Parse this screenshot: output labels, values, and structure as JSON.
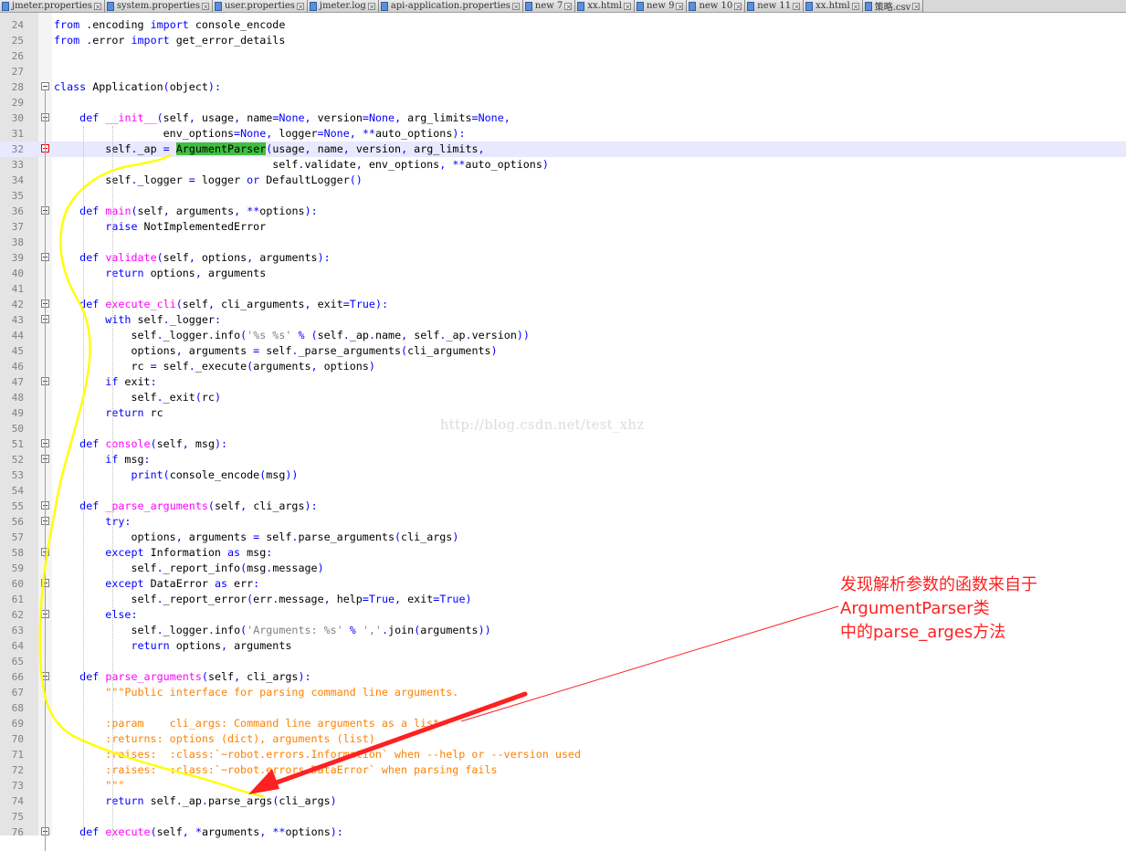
{
  "tabs": [
    {
      "label": "jmeter.properties"
    },
    {
      "label": "system.properties"
    },
    {
      "label": "user.properties"
    },
    {
      "label": "jmeter.log"
    },
    {
      "label": "api-application.properties"
    },
    {
      "label": "new 7"
    },
    {
      "label": "xx.html"
    },
    {
      "label": "new 9"
    },
    {
      "label": "new 10"
    },
    {
      "label": "new 11"
    },
    {
      "label": "xx.html"
    },
    {
      "label": "策略.csv"
    }
  ],
  "editor": {
    "current_line": 32,
    "highlight_word": "ArgumentParser",
    "watermark": "http://blog.csdn.net/test_xhz",
    "annotation": [
      "发现解析参数的函数来自于",
      "ArgumentParser类",
      "中的parse_arges方法"
    ],
    "lines": [
      {
        "n": "24",
        "fold": "",
        "t": "from .encoding import console_encode"
      },
      {
        "n": "25",
        "fold": "",
        "t": "from .error import get_error_details"
      },
      {
        "n": "26",
        "fold": "",
        "t": ""
      },
      {
        "n": "27",
        "fold": "",
        "t": ""
      },
      {
        "n": "28",
        "fold": "box",
        "t": "class Application(object):"
      },
      {
        "n": "29",
        "fold": "",
        "t": ""
      },
      {
        "n": "30",
        "fold": "box",
        "t": "    def __init__(self, usage, name=None, version=None, arg_limits=None,"
      },
      {
        "n": "31",
        "fold": "",
        "t": "                 env_options=None, logger=None, **auto_options):"
      },
      {
        "n": "32",
        "fold": "red",
        "t": "        self._ap = ArgumentParser(usage, name, version, arg_limits,"
      },
      {
        "n": "33",
        "fold": "",
        "t": "                                  self.validate, env_options, **auto_options)"
      },
      {
        "n": "34",
        "fold": "",
        "t": "        self._logger = logger or DefaultLogger()"
      },
      {
        "n": "35",
        "fold": "",
        "t": ""
      },
      {
        "n": "36",
        "fold": "box",
        "t": "    def main(self, arguments, **options):"
      },
      {
        "n": "37",
        "fold": "",
        "t": "        raise NotImplementedError"
      },
      {
        "n": "38",
        "fold": "",
        "t": ""
      },
      {
        "n": "39",
        "fold": "box",
        "t": "    def validate(self, options, arguments):"
      },
      {
        "n": "40",
        "fold": "",
        "t": "        return options, arguments"
      },
      {
        "n": "41",
        "fold": "",
        "t": ""
      },
      {
        "n": "42",
        "fold": "box",
        "t": "    def execute_cli(self, cli_arguments, exit=True):"
      },
      {
        "n": "43",
        "fold": "box",
        "t": "        with self._logger:"
      },
      {
        "n": "44",
        "fold": "",
        "t": "            self._logger.info('%s %s' % (self._ap.name, self._ap.version))"
      },
      {
        "n": "45",
        "fold": "",
        "t": "            options, arguments = self._parse_arguments(cli_arguments)"
      },
      {
        "n": "46",
        "fold": "",
        "t": "            rc = self._execute(arguments, options)"
      },
      {
        "n": "47",
        "fold": "box",
        "t": "        if exit:"
      },
      {
        "n": "48",
        "fold": "",
        "t": "            self._exit(rc)"
      },
      {
        "n": "49",
        "fold": "",
        "t": "        return rc"
      },
      {
        "n": "50",
        "fold": "",
        "t": ""
      },
      {
        "n": "51",
        "fold": "box",
        "t": "    def console(self, msg):"
      },
      {
        "n": "52",
        "fold": "box",
        "t": "        if msg:"
      },
      {
        "n": "53",
        "fold": "",
        "t": "            print(console_encode(msg))"
      },
      {
        "n": "54",
        "fold": "",
        "t": ""
      },
      {
        "n": "55",
        "fold": "box",
        "t": "    def _parse_arguments(self, cli_args):"
      },
      {
        "n": "56",
        "fold": "box",
        "t": "        try:"
      },
      {
        "n": "57",
        "fold": "",
        "t": "            options, arguments = self.parse_arguments(cli_args)"
      },
      {
        "n": "58",
        "fold": "box",
        "t": "        except Information as msg:"
      },
      {
        "n": "59",
        "fold": "",
        "t": "            self._report_info(msg.message)"
      },
      {
        "n": "60",
        "fold": "box",
        "t": "        except DataError as err:"
      },
      {
        "n": "61",
        "fold": "",
        "t": "            self._report_error(err.message, help=True, exit=True)"
      },
      {
        "n": "62",
        "fold": "box",
        "t": "        else:"
      },
      {
        "n": "63",
        "fold": "",
        "t": "            self._logger.info('Arguments: %s' % ','.join(arguments))"
      },
      {
        "n": "64",
        "fold": "",
        "t": "            return options, arguments"
      },
      {
        "n": "65",
        "fold": "",
        "t": ""
      },
      {
        "n": "66",
        "fold": "box",
        "t": "    def parse_arguments(self, cli_args):"
      },
      {
        "n": "67",
        "fold": "",
        "t": "        \"\"\"Public interface for parsing command line arguments."
      },
      {
        "n": "68",
        "fold": "",
        "t": ""
      },
      {
        "n": "69",
        "fold": "",
        "t": "        :param    cli_args: Command line arguments as a list"
      },
      {
        "n": "70",
        "fold": "",
        "t": "        :returns: options (dict), arguments (list)"
      },
      {
        "n": "71",
        "fold": "",
        "t": "        :raises:  :class:`~robot.errors.Information` when --help or --version used"
      },
      {
        "n": "72",
        "fold": "",
        "t": "        :raises:  :class:`~robot.errors.DataError` when parsing fails"
      },
      {
        "n": "73",
        "fold": "",
        "t": "        \"\"\""
      },
      {
        "n": "74",
        "fold": "",
        "t": "        return self._ap.parse_args(cli_args)"
      },
      {
        "n": "75",
        "fold": "",
        "t": ""
      },
      {
        "n": "76",
        "fold": "box",
        "t": "    def execute(self, *arguments, **options):"
      }
    ]
  },
  "colors": {
    "keyword": "#0000ff",
    "function_name": "#ff00ff",
    "string": "#808080",
    "docstring": "#ff8000",
    "highlight": "#3fbf3f",
    "current_line": "#e8e8ff",
    "annotation": "#ff2020",
    "pen_stroke": "#ffff00"
  }
}
